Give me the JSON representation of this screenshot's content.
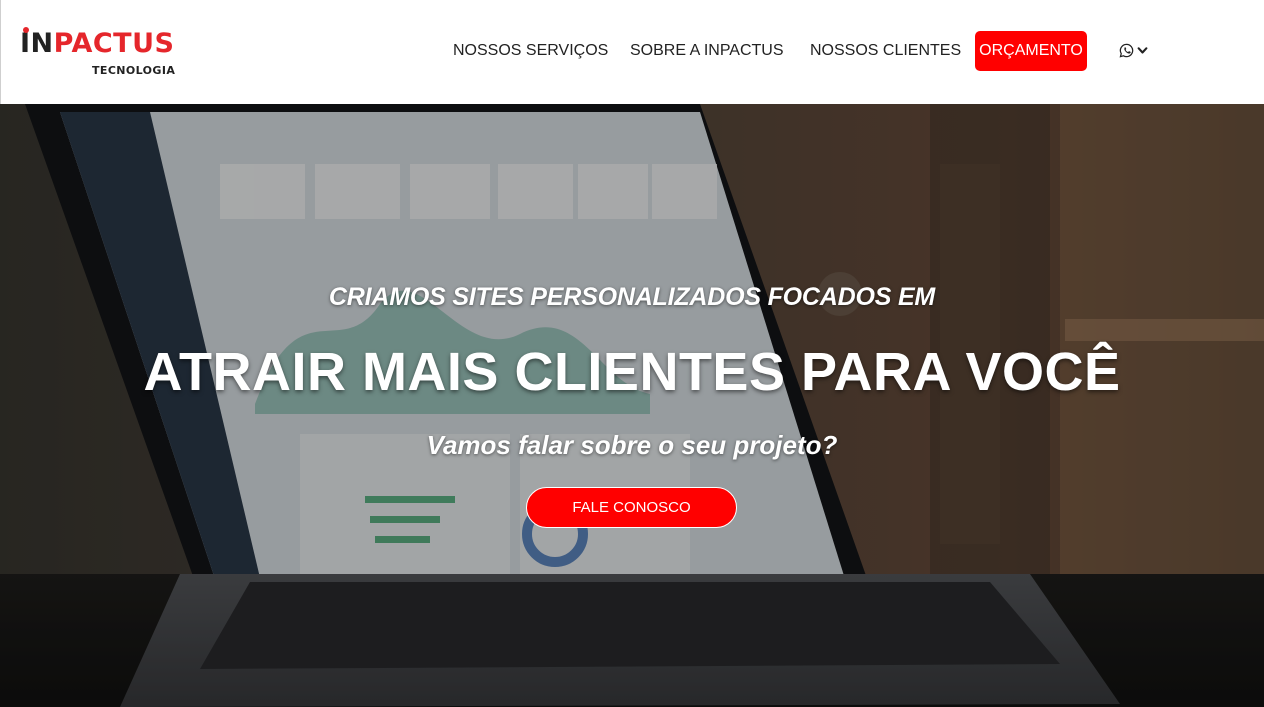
{
  "brand": {
    "logo_in": "IN",
    "logo_pactus": "PACTUS",
    "logo_sub": "TECNOLOGIA",
    "accent_color": "#ff0000"
  },
  "nav": {
    "items": [
      {
        "label": "NOSSOS SERVIÇOS"
      },
      {
        "label": "SOBRE A INPACTUS"
      },
      {
        "label": "NOSSOS CLIENTES"
      }
    ],
    "budget_label": "ORÇAMENTO",
    "whatsapp_icon": "whatsapp-icon",
    "dropdown_icon": "chevron-down-icon"
  },
  "hero": {
    "kicker": "CRIAMOS SITES PERSONALIZADOS FOCADOS EM",
    "title": "ATRAIR MAIS CLIENTES PARA VOCÊ",
    "subtitle": "Vamos falar sobre o seu projeto?",
    "cta_label": "FALE CONOSCO",
    "background": "laptop-dashboard-photo"
  }
}
